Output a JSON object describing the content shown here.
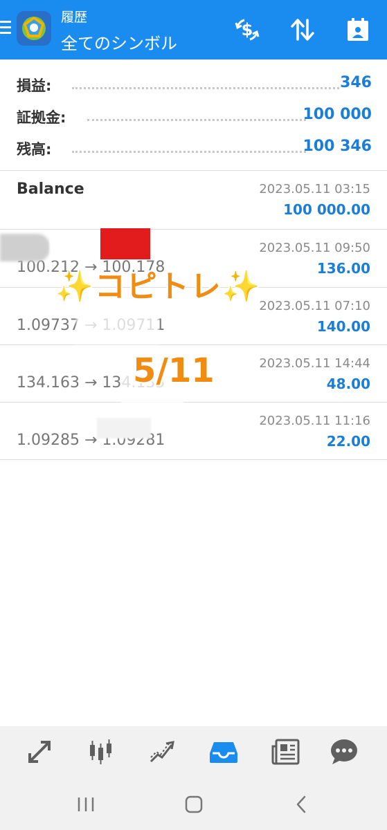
{
  "appbar": {
    "title": "履歴",
    "subtitle": "全てのシンボル",
    "icons": [
      "menu-icon",
      "app-logo",
      "dollar-refresh-icon",
      "sort-arrows-icon",
      "calendar-icon"
    ]
  },
  "summary": {
    "rows": [
      {
        "label": "損益:",
        "value": "346"
      },
      {
        "label": "証拠金:",
        "value": "100 000"
      },
      {
        "label": "残高:",
        "value": "100 346"
      }
    ]
  },
  "history": [
    {
      "left": "Balance",
      "prices": "",
      "date": "2023.05.11 03:15",
      "amount": "100 000.00"
    },
    {
      "left": "",
      "prices": "100.212 → 100.178",
      "date": "2023.05.11 09:50",
      "amount": "136.00"
    },
    {
      "left": "",
      "prices": "1.09737 → 1.09711",
      "date": "2023.05.11 07:10",
      "amount": "140.00"
    },
    {
      "left": "",
      "prices": "134.163 → 134.135",
      "date": "2023.05.11 14:44",
      "amount": "48.00"
    },
    {
      "left": "",
      "prices": "1.09285 → 1.09281",
      "date": "2023.05.11 11:16",
      "amount": "22.00"
    }
  ],
  "overlay": {
    "title": "✨コピトレ✨",
    "date": "5/11"
  },
  "tabbar": {
    "tabs": [
      "trade-icon",
      "chart-candles-icon",
      "trend-icon",
      "history-inbox-icon",
      "news-icon",
      "chat-icon"
    ],
    "active_index": 3,
    "active_color": "#1a8cf0",
    "inactive_color": "#5f5f5f"
  },
  "navbar": {
    "buttons": [
      "recent-apps-icon",
      "home-icon",
      "back-icon"
    ]
  },
  "colors": {
    "accent": "#1a8cf0",
    "value_blue": "#1a7ed8",
    "overlay_orange": "#f08c12"
  }
}
